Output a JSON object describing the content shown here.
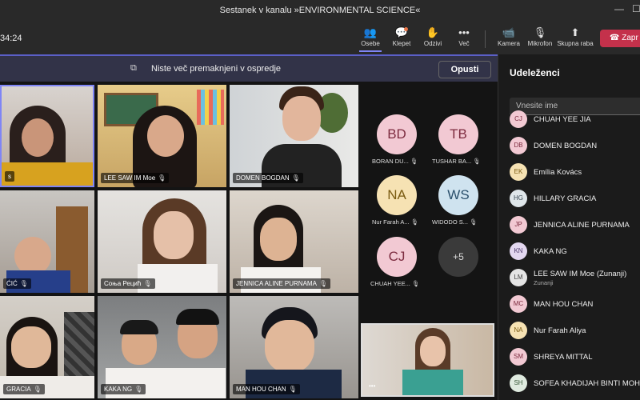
{
  "window": {
    "title": "Sestanek v kanalu »ENVIRONMENTAL SCIENCE«",
    "min": "—",
    "max": "☐"
  },
  "toolbar": {
    "timer": "34:24",
    "people_label": "Osebe",
    "chat_label": "Klepet",
    "react_label": "Odzivi",
    "more_label": "Več",
    "camera_label": "Kamera",
    "mic_label": "Mikrofon",
    "share_label": "Skupna raba",
    "leave_label": "Zapr"
  },
  "notice": {
    "text": "Niste več premaknjeni v ospredje",
    "button": "Opusti"
  },
  "tiles": [
    {
      "name": ""
    },
    {
      "name": "LEE SAW IM Moe"
    },
    {
      "name": "DOMEN BOGDAN"
    },
    {
      "name": "ĆIĆ"
    },
    {
      "name": "Соња Рецић"
    },
    {
      "name": "JENNICA ALINE PURNAMA"
    },
    {
      "name": "GRACIA"
    },
    {
      "name": "KAKA NG"
    },
    {
      "name": "MAN HOU CHAN"
    }
  ],
  "audio_tiles": [
    {
      "initials": "BD",
      "name": "BORAN DU..."
    },
    {
      "initials": "TB",
      "name": "TUSHAR BA..."
    },
    {
      "initials": "NA",
      "name": "Nur Farah A..."
    },
    {
      "initials": "WS",
      "name": "WIDODO S..."
    },
    {
      "initials": "CJ",
      "name": "CHUAH YEE..."
    },
    {
      "initials": "+5",
      "name": ""
    }
  ],
  "sidebar": {
    "heading": "Udeleženci",
    "search_placeholder": "Vnesite ime",
    "participants": [
      {
        "initials": "CJ",
        "name": "CHUAH YEE JIA",
        "sub": ""
      },
      {
        "initials": "DB",
        "name": "DOMEN BOGDAN",
        "sub": ""
      },
      {
        "initials": "EK",
        "name": "Emília Kovács",
        "sub": ""
      },
      {
        "initials": "HG",
        "name": "HILLARY GRACIA",
        "sub": ""
      },
      {
        "initials": "JP",
        "name": "JENNICA ALINE PURNAMA",
        "sub": ""
      },
      {
        "initials": "KN",
        "name": "KAKA NG",
        "sub": ""
      },
      {
        "initials": "LM",
        "name": "LEE SAW IM Moe (Zunanji)",
        "sub": "Zunanji"
      },
      {
        "initials": "MC",
        "name": "MAN HOU CHAN",
        "sub": ""
      },
      {
        "initials": "NA",
        "name": "Nur Farah Aliya",
        "sub": ""
      },
      {
        "initials": "SM",
        "name": "SHREYA MITTAL",
        "sub": ""
      },
      {
        "initials": "SH",
        "name": "SOFEA KHADIJAH BINTI MOHD",
        "sub": ""
      }
    ]
  },
  "colors": {
    "accent": "#5b5fc7",
    "leave": "#c4314b",
    "avatar_bg": "#f2c9d3"
  }
}
